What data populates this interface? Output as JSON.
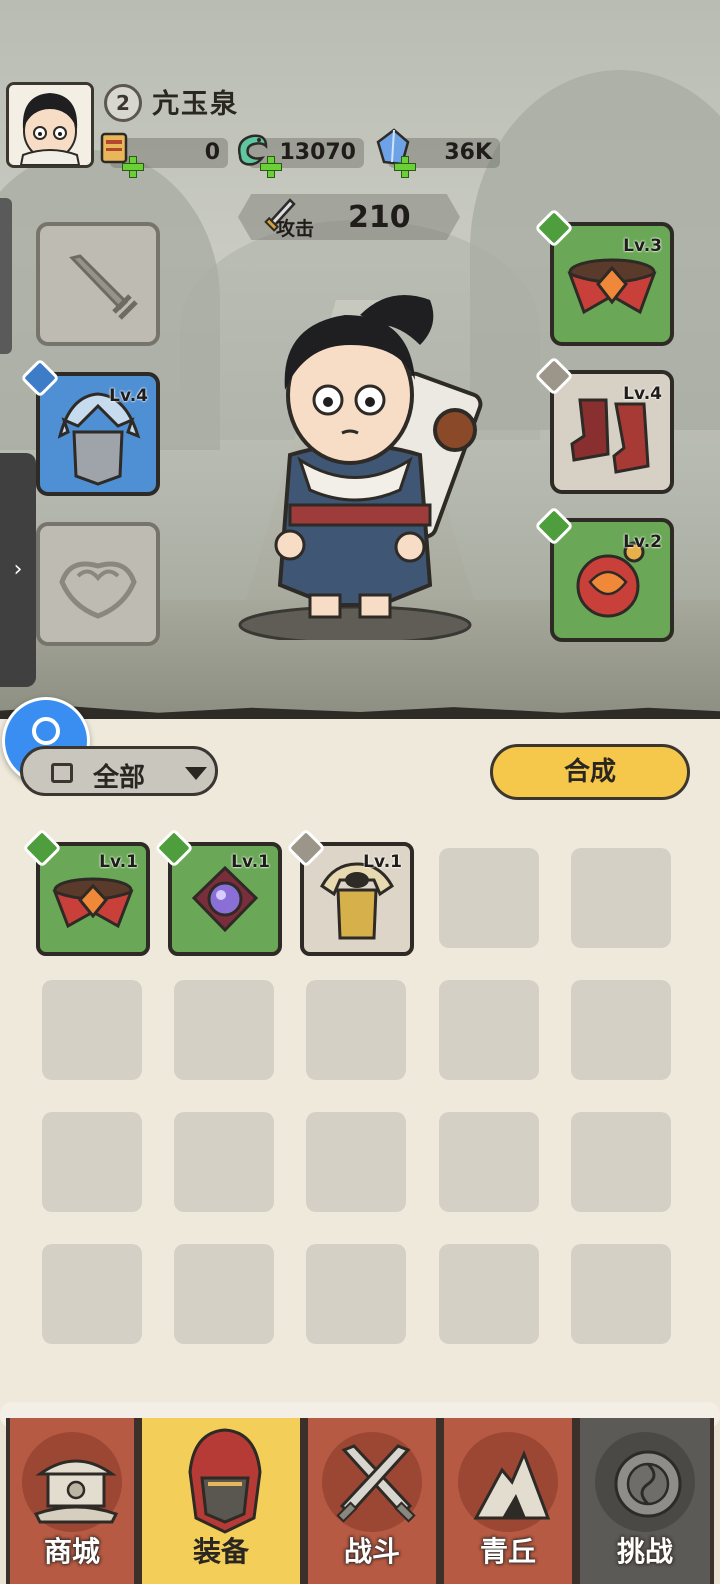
{
  "player": {
    "level": "2",
    "name": "亢玉泉"
  },
  "resources": [
    {
      "name": "scroll",
      "value": "0"
    },
    {
      "name": "jade",
      "value": "13070"
    },
    {
      "name": "crystal",
      "value": "36K"
    }
  ],
  "attack": {
    "label": "攻击",
    "value": "210"
  },
  "equip_slots": {
    "left": [
      {
        "name": "weapon-slot",
        "state": "empty",
        "level": ""
      },
      {
        "name": "helmet-slot",
        "state": "equipped",
        "level": "Lv.4"
      },
      {
        "name": "ring-slot",
        "state": "empty",
        "level": ""
      }
    ],
    "right": [
      {
        "name": "belt-slot",
        "state": "equipped",
        "level": "Lv.3"
      },
      {
        "name": "boots-slot",
        "state": "equipped",
        "level": "Lv.4"
      },
      {
        "name": "amulet-slot",
        "state": "equipped",
        "level": "Lv.2"
      }
    ]
  },
  "filter": {
    "label": "全部"
  },
  "merge_button": {
    "label": "合成"
  },
  "inventory": [
    {
      "item": "belt",
      "level": "Lv.1"
    },
    {
      "item": "amulet",
      "level": "Lv.1"
    },
    {
      "item": "armor",
      "level": "Lv.1"
    }
  ],
  "nav": [
    {
      "label": "商城",
      "icon": "shop-icon"
    },
    {
      "label": "装备",
      "icon": "equipment-icon",
      "active": true
    },
    {
      "label": "战斗",
      "icon": "battle-icon"
    },
    {
      "label": "青丘",
      "icon": "qingqiu-icon"
    },
    {
      "label": "挑战",
      "icon": "challenge-icon"
    }
  ],
  "colors": {
    "slot_green": "#6aa857",
    "slot_blue": "#4f8fd4",
    "merge_yellow": "#f5c84c",
    "nav_red": "#b65a43",
    "nav_active": "#f3cf5a"
  }
}
